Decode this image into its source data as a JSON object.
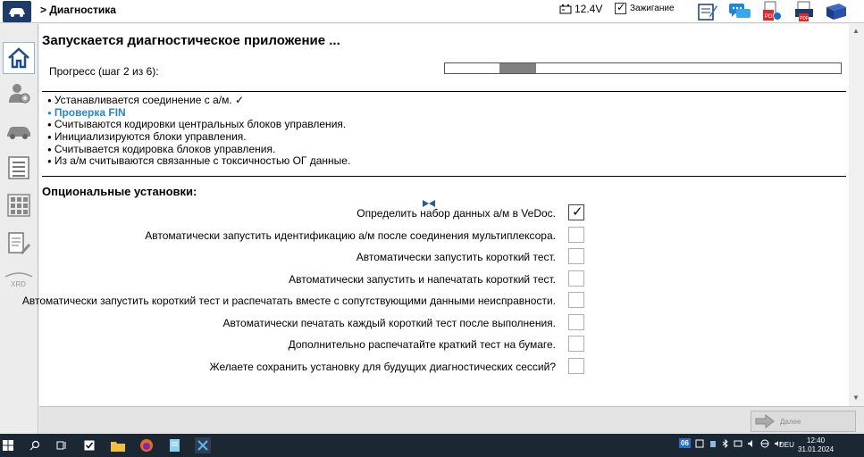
{
  "header": {
    "breadcrumb": "> Диагностика",
    "battery_voltage": "12.4V",
    "ignition_label": "Зажигание",
    "toolbar_icons": [
      "notepad-icon",
      "chat-icon",
      "pdf-document-icon",
      "pdf-printer-icon",
      "manual-book-icon"
    ]
  },
  "sidebar": {
    "items": [
      {
        "icon": "home-icon",
        "active": true
      },
      {
        "icon": "user-settings-icon",
        "active": false
      },
      {
        "icon": "vehicle-icon",
        "active": false
      },
      {
        "icon": "list-icon",
        "active": false
      },
      {
        "icon": "control-units-icon",
        "active": false
      },
      {
        "icon": "documents-tools-icon",
        "active": false
      },
      {
        "icon": "xrd-icon",
        "label": "XRD",
        "active": false
      }
    ]
  },
  "main": {
    "title": "Запускается диагностическое приложение ...",
    "progress_label": "Прогресс (шаг 2 из 6):",
    "progress": {
      "step": 2,
      "total": 6
    },
    "steps": [
      {
        "text": "Устанавливается соединение с а/м. ✓",
        "current": false
      },
      {
        "text": "Проверка FIN",
        "current": true
      },
      {
        "text": "Считываются кодировки центральных блоков управления.",
        "current": false
      },
      {
        "text": "Инициализируются блоки управления.",
        "current": false
      },
      {
        "text": "Считывается кодировка блоков управления.",
        "current": false
      },
      {
        "text": "Из а/м считываются связанные с токсичностью ОГ данные.",
        "current": false
      }
    ],
    "options_title": "Опциональные установки:",
    "options": [
      {
        "label": "Определить набор данных а/м в VeDoc.",
        "checked": true
      },
      {
        "label": "Автоматически запустить идентификацию а/м после соединения мультиплексора.",
        "checked": false
      },
      {
        "label": "Автоматически запустить короткий тест.",
        "checked": false
      },
      {
        "label": "Автоматически запустить и напечатать короткий тест.",
        "checked": false
      },
      {
        "label": "Автоматически запустить короткий тест и распечатать вместе с сопутствующими данными неисправности.",
        "checked": false
      },
      {
        "label": "Автоматически печатать каждый короткий тест после выполнения.",
        "checked": false
      },
      {
        "label": "Дополнительно распечатайте краткий тест на бумаге.",
        "checked": false
      },
      {
        "label": "Желаете сохранить установку для будущих диагностических сессий?",
        "checked": false
      }
    ]
  },
  "footer": {
    "next_label": "Далее"
  },
  "taskbar": {
    "tray_badge": "06",
    "language": "DEU",
    "time": "12:40",
    "date": "31.01.2024"
  },
  "colors": {
    "header_logo": "#1e3a68",
    "current_step": "#2a86c8",
    "progress_fill": "#808080",
    "taskbar": "#1c2734"
  }
}
